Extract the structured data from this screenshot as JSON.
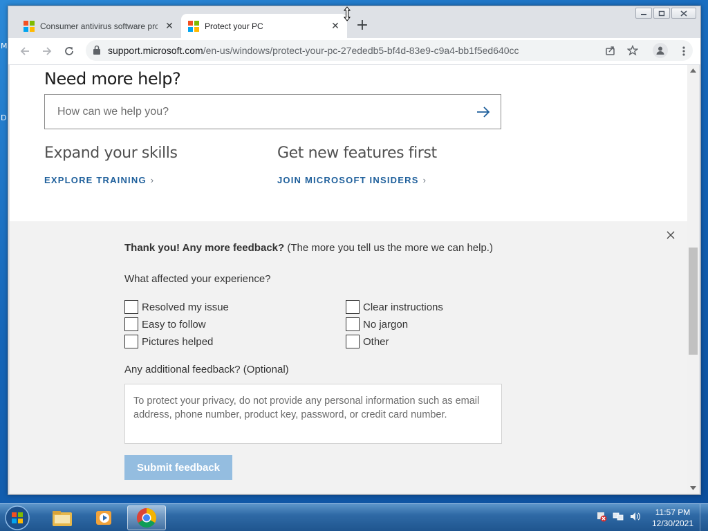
{
  "desktop": {
    "edge_letters": [
      "M",
      "D"
    ]
  },
  "browser": {
    "tabs": [
      {
        "title": "Consumer antivirus software providers",
        "active": false
      },
      {
        "title": "Protect your PC",
        "active": true
      }
    ],
    "new_tab": "+",
    "url_host": "support.microsoft.com",
    "url_path": "/en-us/windows/protect-your-pc-27ededb5-bf4d-83e9-c9a4-bb1f5ed640cc"
  },
  "page": {
    "help_heading": "Need more help?",
    "search_placeholder": "How can we help you?",
    "col1": {
      "heading": "Expand your skills",
      "link": "EXPLORE TRAINING"
    },
    "col2": {
      "heading": "Get new features first",
      "link": "JOIN MICROSOFT INSIDERS"
    },
    "chevron": "›"
  },
  "feedback": {
    "thanks_bold": "Thank you! Any more feedback?",
    "thanks_rest": " (The more you tell us the more we can help.)",
    "question": "What affected your experience?",
    "options_left": [
      "Resolved my issue",
      "Easy to follow",
      "Pictures helped"
    ],
    "options_right": [
      "Clear instructions",
      "No jargon",
      "Other"
    ],
    "additional_label": "Any additional feedback? (Optional)",
    "textarea_placeholder": "To protect your privacy, do not provide any personal information such as email address, phone number, product key, password, or credit card number.",
    "submit_label": "Submit feedback"
  },
  "taskbar": {
    "time": "11:57 PM",
    "date": "12/30/2021"
  },
  "colors": {
    "accent_link": "#1e5f9b",
    "submit_disabled": "#94bde0",
    "feedback_bg": "#f2f2f2"
  }
}
